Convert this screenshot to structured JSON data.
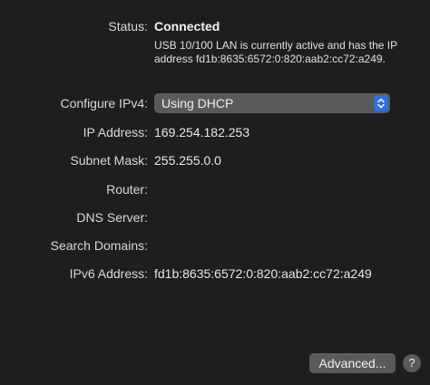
{
  "status": {
    "label": "Status:",
    "value": "Connected",
    "description": "USB 10/100 LAN is currently active and has the IP address fd1b:8635:6572:0:820:aab2:cc72:a249."
  },
  "configure_ipv4": {
    "label": "Configure IPv4:",
    "selected": "Using DHCP",
    "icon": "chevron-up-down-icon",
    "accent_color": "#2f6fe0"
  },
  "ip_address": {
    "label": "IP Address:",
    "value": "169.254.182.253"
  },
  "subnet_mask": {
    "label": "Subnet Mask:",
    "value": "255.255.0.0"
  },
  "router": {
    "label": "Router:",
    "value": ""
  },
  "dns_server": {
    "label": "DNS Server:",
    "value": ""
  },
  "search_domains": {
    "label": "Search Domains:",
    "value": ""
  },
  "ipv6_address": {
    "label": "IPv6 Address:",
    "value": "fd1b:8635:6572:0:820:aab2:cc72:a249"
  },
  "footer": {
    "advanced_label": "Advanced...",
    "help_label": "?"
  }
}
